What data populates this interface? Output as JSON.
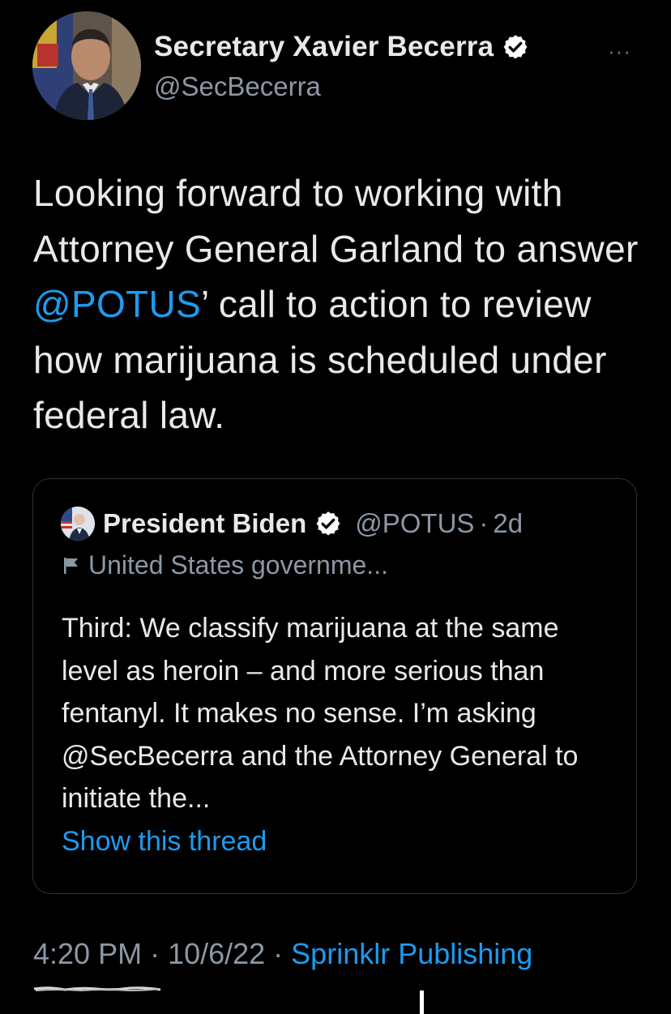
{
  "author": {
    "display_name": "Secretary Xavier Becerra",
    "handle": "@SecBecerra",
    "verified_icon": "verified-badge-icon",
    "more_label": "···"
  },
  "tweet": {
    "text_before": "Looking forward to working with Attorney General Garland to answer ",
    "mention": "@POTUS",
    "text_after": "’ call to action to review how marijuana is scheduled under federal law."
  },
  "quote": {
    "display_name": "President Biden",
    "handle": "@POTUS",
    "separator": "·",
    "time": "2d",
    "label_icon": "flag-icon",
    "label": "United States governme...",
    "text": "Third: We classify marijuana at the same level as heroin – and more serious than fentanyl. It makes no sense. I’m asking @SecBecerra and the Attorney General to initiate the...",
    "show_thread": "Show this thread"
  },
  "meta": {
    "time": "4:20 PM",
    "date": "· 10/6/22 ·",
    "source": "Sprinklr Publishing"
  },
  "colors": {
    "background": "#000000",
    "text": "#e7e9ea",
    "secondary": "#8b98a5",
    "link": "#1d9bf0",
    "border": "#2f3336"
  }
}
